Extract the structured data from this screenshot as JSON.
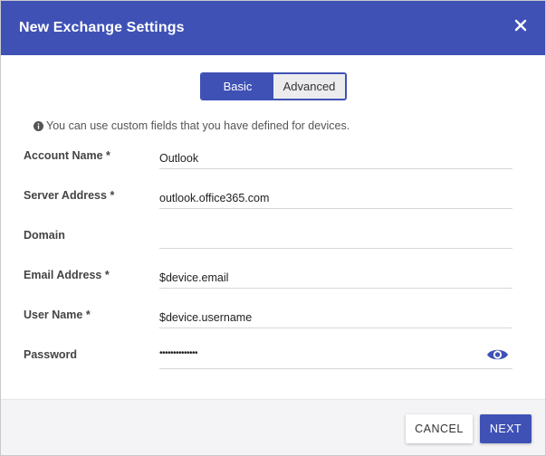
{
  "dialog": {
    "title": "New Exchange Settings",
    "close_icon": "close-icon"
  },
  "colors": {
    "primary": "#3f51b5",
    "footer_bg": "#f4f4f6"
  },
  "tabs": {
    "basic": "Basic",
    "advanced": "Advanced",
    "selected": "Basic"
  },
  "info": {
    "icon": "info-icon",
    "text": "You can use custom fields that you have defined for devices."
  },
  "fields": {
    "account_name": {
      "label": "Account Name",
      "required": "*",
      "value": "Outlook"
    },
    "server_address": {
      "label": "Server Address",
      "required": "*",
      "value": "outlook.office365.com"
    },
    "domain": {
      "label": "Domain",
      "value": ""
    },
    "email_address": {
      "label": "Email Address",
      "required": "*",
      "value": "$device.email"
    },
    "user_name": {
      "label": "User Name",
      "required": "*",
      "value": "$device.username"
    },
    "password": {
      "label": "Password",
      "masked_value": "••••••••••••••",
      "toggle_icon": "eye-icon"
    }
  },
  "footer": {
    "cancel_label": "CANCEL",
    "next_label": "NEXT"
  }
}
